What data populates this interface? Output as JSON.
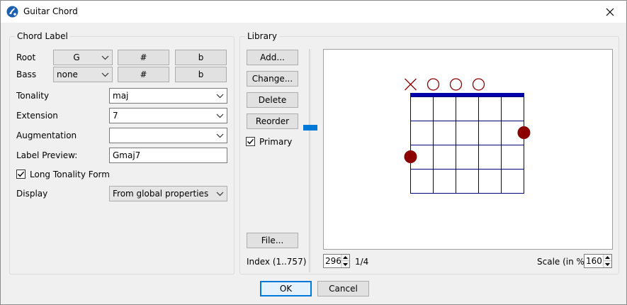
{
  "window": {
    "title": "Guitar Chord"
  },
  "chord_label": {
    "title": "Chord Label",
    "root": {
      "label": "Root",
      "value": "G",
      "sharp": "#",
      "flat": "b"
    },
    "bass": {
      "label": "Bass",
      "value": "none",
      "sharp": "#",
      "flat": "b"
    },
    "tonality": {
      "label": "Tonality",
      "value": "maj"
    },
    "extension": {
      "label": "Extension",
      "value": "7"
    },
    "augmentation": {
      "label": "Augmentation",
      "value": ""
    },
    "label_preview": {
      "label": "Label Preview:",
      "value": "Gmaj7"
    },
    "long_tonality": {
      "label": "Long Tonality Form",
      "checked": true
    },
    "display": {
      "label": "Display",
      "value": "From global properties"
    }
  },
  "library": {
    "title": "Library",
    "add": "Add...",
    "change": "Change...",
    "delete": "Delete",
    "reorder": "Reorder",
    "primary": {
      "label": "Primary",
      "checked": true
    },
    "file": "File...",
    "index_label": "Index (1..757)",
    "index_value": "296",
    "index_page": "1/4",
    "scale_label": "Scale (in %)",
    "scale_value": "160"
  },
  "diagram": {
    "strings": 6,
    "frets": 4,
    "open_markers": [
      "x",
      "o",
      "o",
      "o"
    ],
    "dots": [
      {
        "string": 1,
        "fret": 3
      },
      {
        "string": 6,
        "fret": 2
      }
    ],
    "colors": {
      "grid": "#000080",
      "dot": "#8b0000",
      "marker": "#8b0000"
    }
  },
  "footer": {
    "ok": "OK",
    "cancel": "Cancel"
  }
}
